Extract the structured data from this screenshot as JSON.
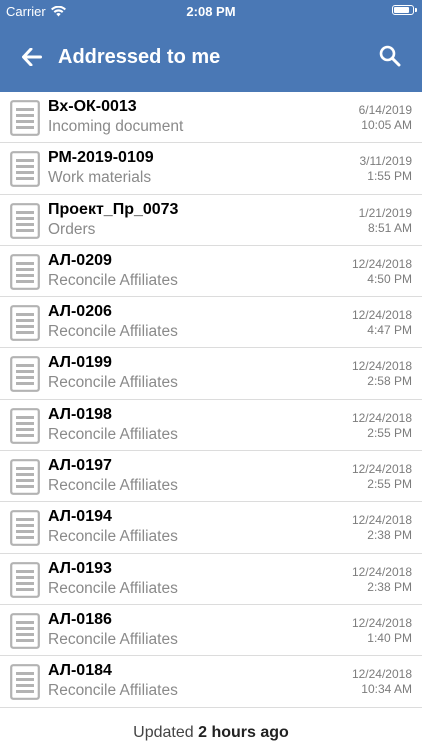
{
  "status_bar": {
    "carrier": "Carrier",
    "time": "2:08 PM"
  },
  "nav": {
    "title": "Addressed to me",
    "back_icon": "arrow-left-icon",
    "search_icon": "search-icon"
  },
  "colors": {
    "header": "#4A78B5",
    "icon_gray": "#b3b3b3"
  },
  "documents": [
    {
      "name": "Вх-ОК-0013",
      "type": "Incoming document",
      "date": "6/14/2019",
      "time": "10:05 AM"
    },
    {
      "name": "РМ-2019-0109",
      "type": "Work materials",
      "date": "3/11/2019",
      "time": "1:55 PM"
    },
    {
      "name": "Проект_Пр_0073",
      "type": "Orders",
      "date": "1/21/2019",
      "time": "8:51 AM"
    },
    {
      "name": "АЛ-0209",
      "type": "Reconcile Affiliates",
      "date": "12/24/2018",
      "time": "4:50 PM"
    },
    {
      "name": "АЛ-0206",
      "type": "Reconcile Affiliates",
      "date": "12/24/2018",
      "time": "4:47 PM"
    },
    {
      "name": "АЛ-0199",
      "type": "Reconcile Affiliates",
      "date": "12/24/2018",
      "time": "2:58 PM"
    },
    {
      "name": "АЛ-0198",
      "type": "Reconcile Affiliates",
      "date": "12/24/2018",
      "time": "2:55 PM"
    },
    {
      "name": "АЛ-0197",
      "type": "Reconcile Affiliates",
      "date": "12/24/2018",
      "time": "2:55 PM"
    },
    {
      "name": "АЛ-0194",
      "type": "Reconcile Affiliates",
      "date": "12/24/2018",
      "time": "2:38 PM"
    },
    {
      "name": "АЛ-0193",
      "type": "Reconcile Affiliates",
      "date": "12/24/2018",
      "time": "2:38 PM"
    },
    {
      "name": "АЛ-0186",
      "type": "Reconcile Affiliates",
      "date": "12/24/2018",
      "time": "1:40 PM"
    },
    {
      "name": "АЛ-0184",
      "type": "Reconcile Affiliates",
      "date": "12/24/2018",
      "time": "10:34 AM"
    }
  ],
  "footer": {
    "prefix": "Updated",
    "age": "2 hours ago"
  }
}
